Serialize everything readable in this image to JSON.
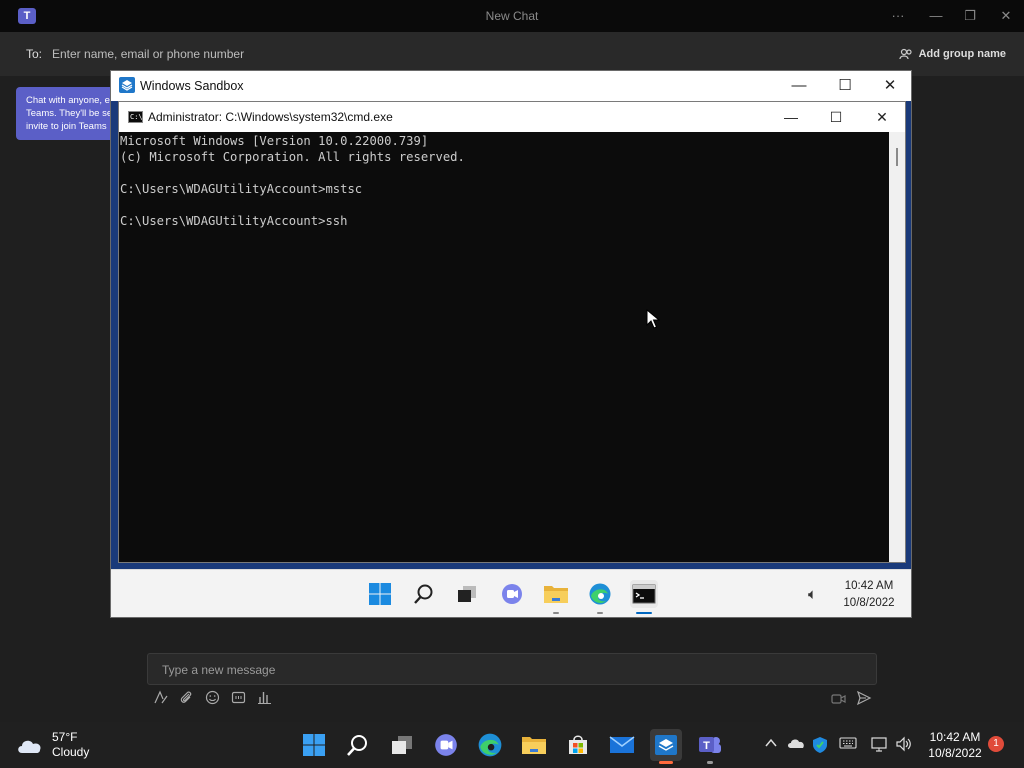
{
  "teams": {
    "title": "New Chat",
    "to_label": "To:",
    "to_placeholder": "Enter name, email or phone number",
    "add_group_name": "Add group name",
    "chat_bubble": [
      "Chat with anyone, e",
      "Teams. They'll be se",
      "invite to join Teams"
    ],
    "compose_placeholder": "Type a new message"
  },
  "sandbox": {
    "title": "Windows Sandbox",
    "cmd": {
      "title": "Administrator: C:\\Windows\\system32\\cmd.exe",
      "lines": [
        "Microsoft Windows [Version 10.0.22000.739]",
        "(c) Microsoft Corporation. All rights reserved.",
        "",
        "C:\\Users\\WDAGUtilityAccount>mstsc",
        "",
        "C:\\Users\\WDAGUtilityAccount>ssh"
      ]
    },
    "taskbar": {
      "time": "10:42 AM",
      "date": "10/8/2022"
    }
  },
  "host_taskbar": {
    "weather_temp": "57°F",
    "weather_cond": "Cloudy",
    "time": "10:42 AM",
    "date": "10/8/2022",
    "notifications": "1"
  },
  "colors": {
    "teams_purple": "#5b5fc7",
    "cmd_bg": "#0c0c0c",
    "taskbar_dark": "#202020",
    "active_indicator": "#0067c0"
  }
}
